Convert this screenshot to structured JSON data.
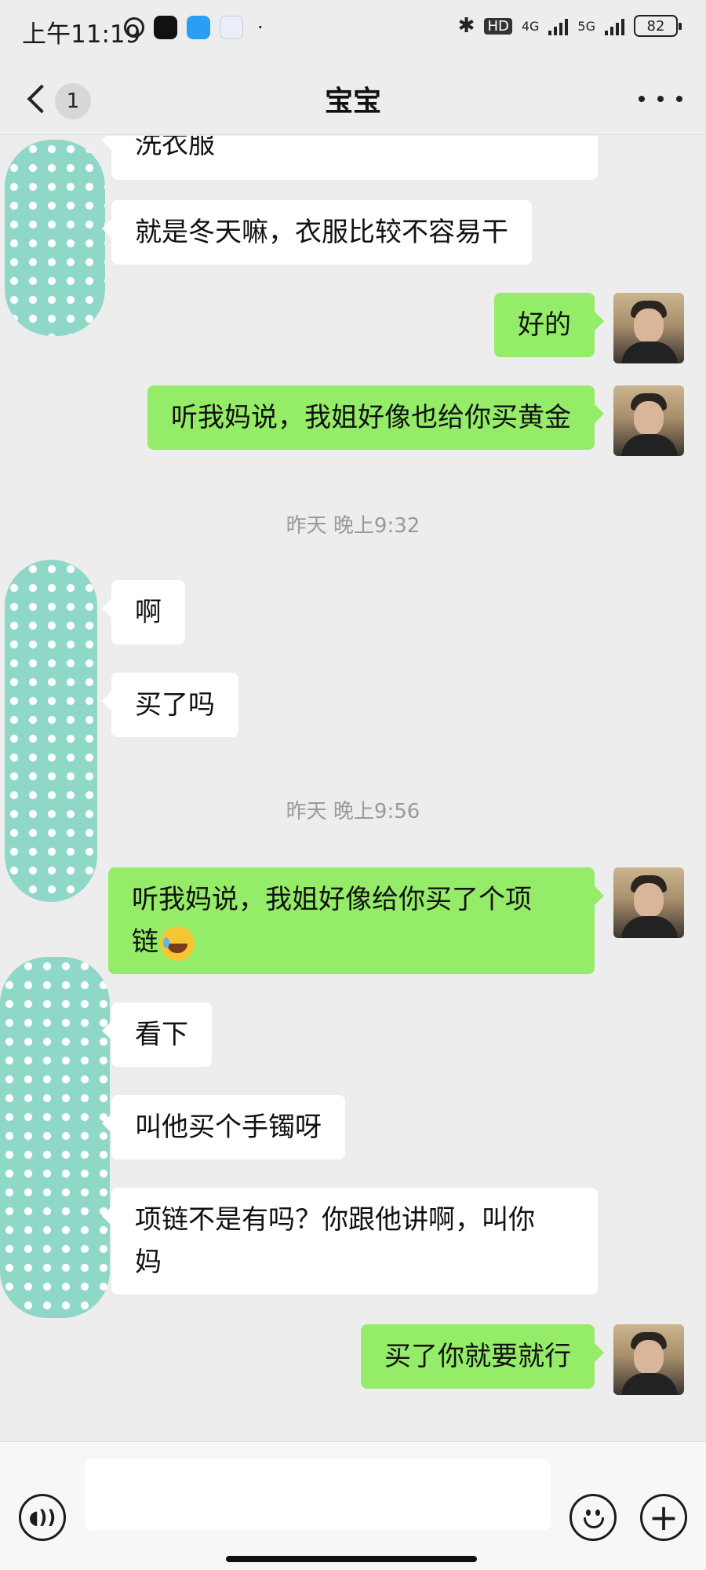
{
  "status_bar": {
    "time": "上午11:19",
    "network_1": "4G",
    "network_2": "5G",
    "hd_label": "HD",
    "battery": "82"
  },
  "header": {
    "unread_count": "1",
    "title": "宝宝"
  },
  "messages": [
    {
      "side": "in",
      "text": "洗衣服"
    },
    {
      "side": "in",
      "text": "就是冬天嘛，衣服比较不容易干"
    },
    {
      "side": "out",
      "text": "好的"
    },
    {
      "side": "out",
      "text": "听我妈说，我姐好像也给你买黄金"
    },
    {
      "type": "timestamp",
      "text": "昨天 晚上9:32"
    },
    {
      "side": "in",
      "text": "啊"
    },
    {
      "side": "in",
      "text": "买了吗"
    },
    {
      "type": "timestamp",
      "text": "昨天 晚上9:56"
    },
    {
      "side": "out",
      "text_line1": "听我妈说，我姐好像给你买了个项",
      "text_line2": "链",
      "emoji": "crying-laughing-emoji"
    },
    {
      "side": "in",
      "text": "看下"
    },
    {
      "side": "in",
      "text": "叫他买个手镯呀"
    },
    {
      "side": "in",
      "text_line1": "项链不是有吗？你跟他讲啊，叫你",
      "text_line2": "妈"
    },
    {
      "side": "out",
      "text": "买了你就要就行"
    }
  ],
  "input_bar": {
    "placeholder": ""
  },
  "colors": {
    "background": "#ededed",
    "incoming_bubble": "#ffffff",
    "outgoing_bubble": "#95ec69",
    "timestamp_text": "#9a9a9a",
    "avatar_pattern": "#8fd8c8"
  }
}
